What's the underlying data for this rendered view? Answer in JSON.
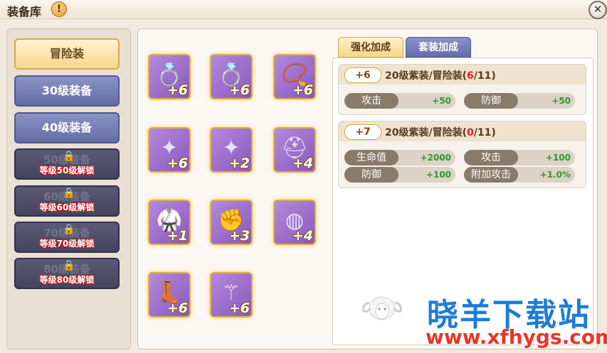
{
  "window": {
    "title": "装备库",
    "warn_icon": "!",
    "close_icon": "✕"
  },
  "categories": [
    {
      "label": "冒险装",
      "state": "active"
    },
    {
      "label": "30级装备",
      "state": "normal"
    },
    {
      "label": "40级装备",
      "state": "normal"
    },
    {
      "label": "50级装备",
      "state": "locked",
      "lock_text": "等级50级解锁"
    },
    {
      "label": "60级装备",
      "state": "locked",
      "lock_text": "等级60级解锁"
    },
    {
      "label": "70级装备",
      "state": "locked",
      "lock_text": "等级70级解锁"
    },
    {
      "label": "80级装备",
      "state": "locked",
      "lock_text": "等级80级解锁"
    }
  ],
  "equipment": [
    {
      "name": "ring-icon",
      "glyph": "💍",
      "level": "+6"
    },
    {
      "name": "ring-icon",
      "glyph": "💍",
      "level": "+6"
    },
    {
      "name": "necklace-icon",
      "glyph": "📿",
      "level": "+6"
    },
    {
      "name": "earring-icon",
      "glyph": "✦",
      "level": "+6"
    },
    {
      "name": "earring-icon",
      "glyph": "✦",
      "level": "+2"
    },
    {
      "name": "helmet-icon",
      "glyph": "⛑",
      "level": "+4"
    },
    {
      "name": "armor-icon",
      "glyph": "🥋",
      "level": "+1"
    },
    {
      "name": "gauntlet-icon",
      "glyph": "✊",
      "level": "+3"
    },
    {
      "name": "belt-icon",
      "glyph": "◍",
      "level": "+4"
    },
    {
      "name": "boots-icon",
      "glyph": "👢",
      "level": "+6"
    },
    {
      "name": "staff-icon",
      "glyph": "⚚",
      "level": "+6"
    }
  ],
  "tabs": [
    {
      "label": "强化加成",
      "active": true
    },
    {
      "label": "套装加成",
      "active": false
    }
  ],
  "sets": [
    {
      "badge": "+6",
      "name": "20级紫装/冒险装",
      "progress_open": "(",
      "progress_current": "6",
      "progress_total": "/11)",
      "stats": [
        {
          "label": "攻击",
          "value": "+50"
        },
        {
          "label": "防御",
          "value": "+50"
        }
      ]
    },
    {
      "badge": "+7",
      "name": "20级紫装/冒险装",
      "progress_open": "(",
      "progress_current": "0",
      "progress_total": "/11)",
      "stats": [
        {
          "label": "生命值",
          "value": "+2000"
        },
        {
          "label": "攻击",
          "value": "+100"
        },
        {
          "label": "防御",
          "value": "+100"
        },
        {
          "label": "附加攻击",
          "value": "+1.0%"
        }
      ]
    }
  ],
  "watermark": {
    "cn": "晓羊下载站",
    "url": "www.xfhygs.com"
  },
  "colors": {
    "accent_gold": "#d9b04e",
    "slot_purple": "#9a68c8",
    "stat_green": "#2a9a2a",
    "progress_red": "#e02020"
  }
}
